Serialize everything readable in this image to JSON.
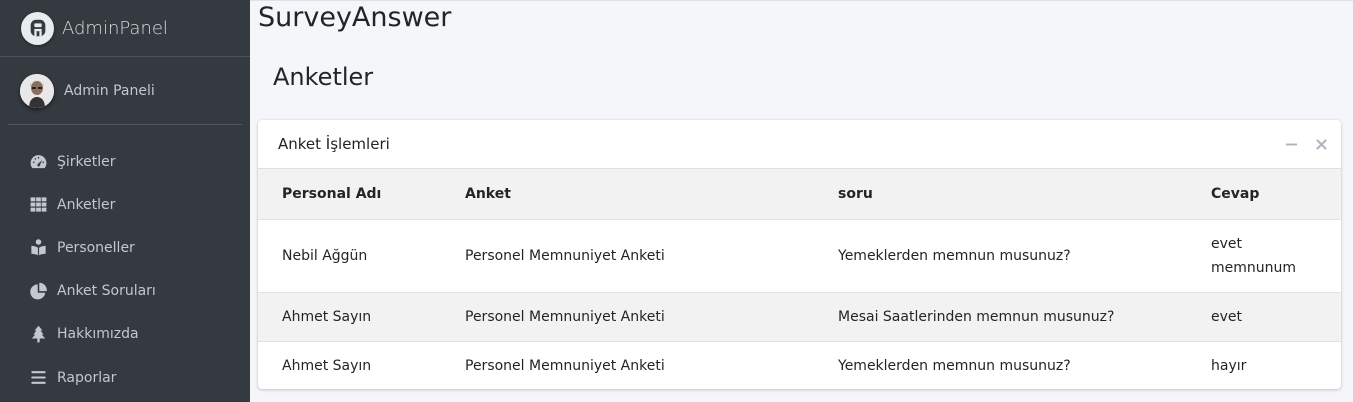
{
  "brand": {
    "name": "AdminPanel"
  },
  "user": {
    "name": "Admin Paneli"
  },
  "sidebar": {
    "items": [
      {
        "label": "Şirketler",
        "icon": "tachometer-icon"
      },
      {
        "label": "Anketler",
        "icon": "grid-icon"
      },
      {
        "label": "Personeller",
        "icon": "reader-icon"
      },
      {
        "label": "Anket Soruları",
        "icon": "pie-chart-icon"
      },
      {
        "label": "Hakkımızda",
        "icon": "tree-icon"
      },
      {
        "label": "Raporlar",
        "icon": "list-icon"
      }
    ]
  },
  "page": {
    "app_title": "SurveyAnswer",
    "heading": "Anketler"
  },
  "card": {
    "title": "Anket İşlemleri"
  },
  "table": {
    "headers": [
      "Personal Adı",
      "Anket",
      "soru",
      "Cevap"
    ],
    "rows": [
      [
        "Nebil Ağgün",
        "Personel Memnuniyet Anketi",
        "Yemeklerden memnun musunuz?",
        "evet memnunum"
      ],
      [
        "Ahmet Sayın",
        "Personel Memnuniyet Anketi",
        "Mesai Saatlerinden memnun musunuz?",
        "evet"
      ],
      [
        "Ahmet Sayın",
        "Personel Memnuniyet Anketi",
        "Yemeklerden memnun musunuz?",
        "hayır"
      ]
    ]
  }
}
